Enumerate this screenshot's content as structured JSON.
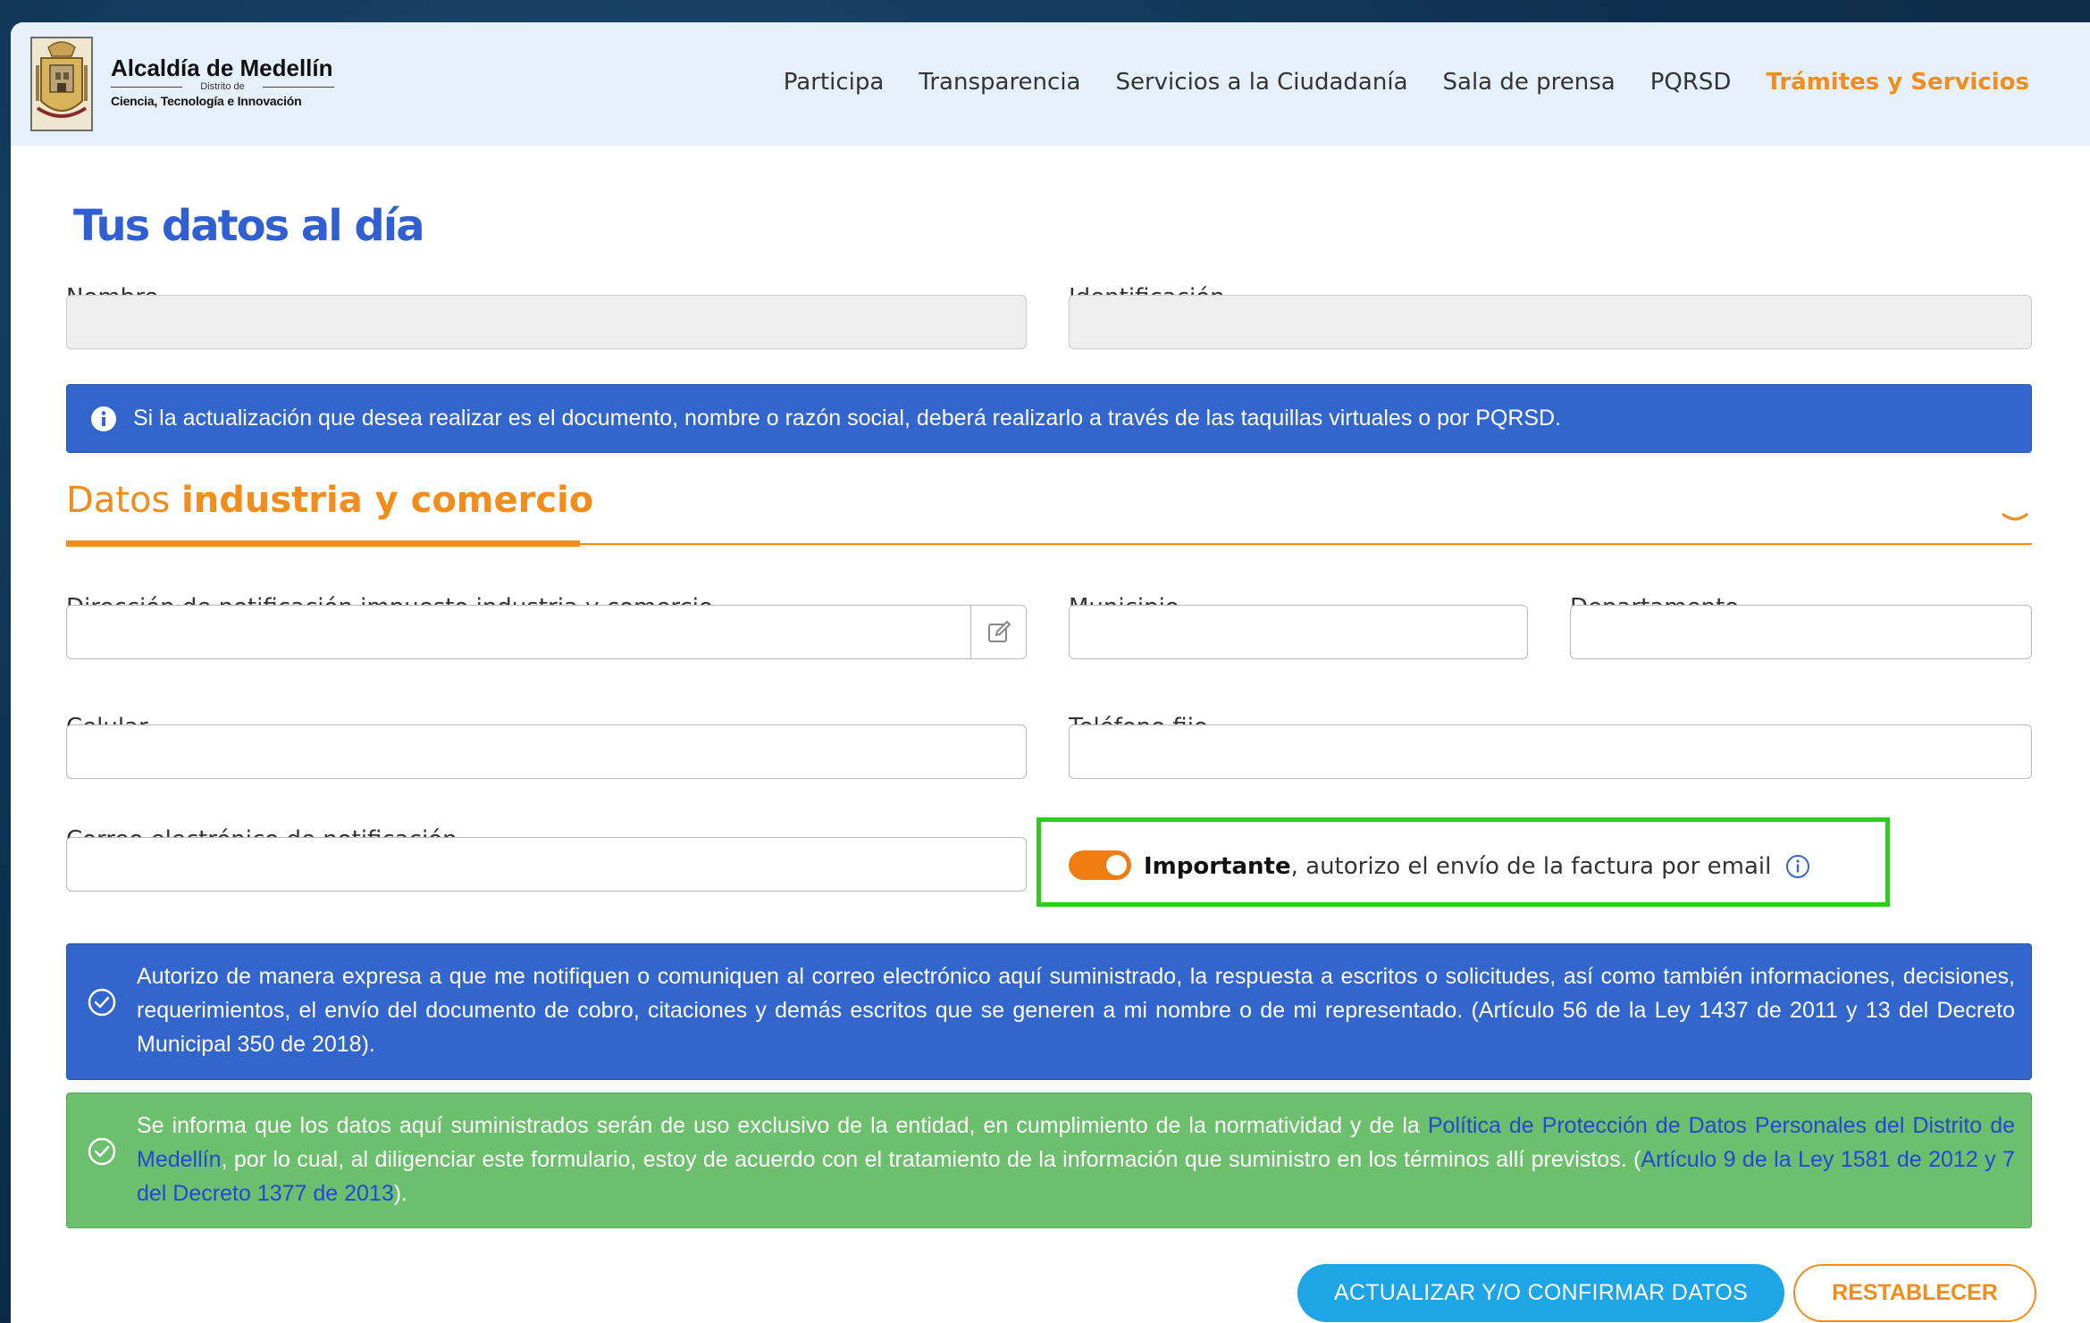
{
  "header": {
    "logo_title": "Alcaldía de Medellín",
    "logo_district": "Distrito de",
    "logo_subtitle": "Ciencia, Tecnología e Innovación",
    "nav": [
      "Participa",
      "Transparencia",
      "Servicios a la Ciudadanía",
      "Sala de prensa",
      "PQRSD",
      "Trámites y Servicios"
    ],
    "active_nav": "Trámites y Servicios"
  },
  "page": {
    "title": "Tus datos al día"
  },
  "personal": {
    "name_label": "Nombre",
    "name_value": "",
    "id_label": "Identificación",
    "id_value": ""
  },
  "info_banner": {
    "text": "Si la actualización que desea realizar es el documento, nombre o razón social, deberá realizarlo a través de las taquillas virtuales o por PQRSD."
  },
  "section": {
    "title_prefix": "Datos ",
    "title_bold": "industria y comercio"
  },
  "form": {
    "address_label": "Dirección de notificación impuesto industria y comercio",
    "address_value": "",
    "municipality_label": "Municipio",
    "municipality_value": "",
    "department_label": "Departamento",
    "department_value": "",
    "mobile_label": "Celular",
    "mobile_value": "",
    "landline_label": "Teléfono fijo",
    "landline_value": "",
    "email_label": "Correo electrónico de notificación",
    "email_value": ""
  },
  "toggle": {
    "bold": "Importante",
    "text": ", autorizo el envío de la factura por email",
    "state": "on"
  },
  "notices": {
    "authorization": "Autorizo de manera expresa a que me notifiquen o comuniquen al correo electrónico aquí suministrado, la respuesta a escritos o solicitudes, así como también informaciones, decisiones, requerimientos, el envío del documento de cobro, citaciones y demás escritos que se generen a mi nombre o de mi representado. (Artículo 56 de la Ley 1437 de 2011 y 13 del Decreto Municipal 350 de 2018).",
    "privacy_part1": "Se informa que los datos aquí suministrados serán de uso exclusivo de la entidad, en cumplimiento de la normatividad y de la ",
    "privacy_link1": "Política de Protección de Datos Personales del Distrito de Medellín",
    "privacy_part2": ", por lo cual, al diligenciar este formulario, estoy de acuerdo con el tratamiento de la información que suministro en los términos allí previstos. (",
    "privacy_link2": "Artículo 9 de la Ley 1581 de 2012 y 7 del Decreto 1377 de 2013",
    "privacy_part3": ")."
  },
  "buttons": {
    "update": "ACTUALIZAR Y/O CONFIRMAR DATOS",
    "reset": "RESTABLECER"
  },
  "colors": {
    "brand_blue": "#2f5fd0",
    "orange": "#f28c1a",
    "banner_blue": "#3366cc",
    "green": "#6cbf6c",
    "highlight": "#2ecc1f",
    "button_blue": "#1ea5e6"
  }
}
